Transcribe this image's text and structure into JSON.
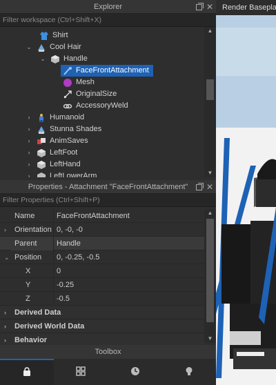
{
  "explorer": {
    "title": "Explorer",
    "filter_placeholder": "Filter workspace (Ctrl+Shift+X)",
    "tree": [
      {
        "label": "Shirt",
        "icon": "shirt-icon",
        "level": 3,
        "chev": ""
      },
      {
        "label": "Cool Hair",
        "icon": "accessory-icon",
        "level": 2,
        "chev": "down"
      },
      {
        "label": "Handle",
        "icon": "part-icon",
        "level": 3,
        "chev": "down"
      },
      {
        "label": "FaceFrontAttachment",
        "icon": "attachment-icon",
        "level": 4,
        "chev": "",
        "selected": true
      },
      {
        "label": "Mesh",
        "icon": "mesh-icon",
        "level": 4,
        "chev": ""
      },
      {
        "label": "OriginalSize",
        "icon": "value-icon",
        "level": 4,
        "chev": ""
      },
      {
        "label": "AccessoryWeld",
        "icon": "weld-icon",
        "level": 4,
        "chev": ""
      },
      {
        "label": "Humanoid",
        "icon": "humanoid-icon",
        "level": 2,
        "chev": "right"
      },
      {
        "label": "Stunna Shades",
        "icon": "accessory-icon",
        "level": 2,
        "chev": "right"
      },
      {
        "label": "AnimSaves",
        "icon": "model-icon",
        "level": 2,
        "chev": "right"
      },
      {
        "label": "LeftFoot",
        "icon": "part-icon",
        "level": 2,
        "chev": "right"
      },
      {
        "label": "LeftHand",
        "icon": "part-icon",
        "level": 2,
        "chev": "right"
      },
      {
        "label": "LeftLowerArm",
        "icon": "part-icon",
        "level": 2,
        "chev": "right"
      }
    ]
  },
  "properties": {
    "title": "Properties - Attachment \"FaceFrontAttachment\"",
    "filter_placeholder": "Filter Properties (Ctrl+Shift+P)",
    "rows": [
      {
        "name": "Name",
        "value": "FaceFrontAttachment",
        "kind": "plain"
      },
      {
        "name": "Orientation",
        "value": "0, -0, -0",
        "kind": "collapsed"
      },
      {
        "name": "Parent",
        "value": "Handle",
        "kind": "highlight"
      },
      {
        "name": "Position",
        "value": "0, -0.25, -0.5",
        "kind": "expanded"
      },
      {
        "name": "X",
        "value": "0",
        "kind": "child"
      },
      {
        "name": "Y",
        "value": "-0.25",
        "kind": "child"
      },
      {
        "name": "Z",
        "value": "-0.5",
        "kind": "child"
      },
      {
        "name": "Derived Data",
        "value": "",
        "kind": "section"
      },
      {
        "name": "Derived World Data",
        "value": "",
        "kind": "section"
      },
      {
        "name": "Behavior",
        "value": "",
        "kind": "section"
      }
    ]
  },
  "toolbox": {
    "title": "Toolbox",
    "tabs": [
      "bag-icon",
      "grid-icon",
      "clock-icon",
      "bulb-icon"
    ],
    "active_tab": 0
  },
  "viewport": {
    "tab_label": "Render Baseplate"
  },
  "colors": {
    "selection": "#1d62b5",
    "panel_bg": "#2e2e2e"
  }
}
